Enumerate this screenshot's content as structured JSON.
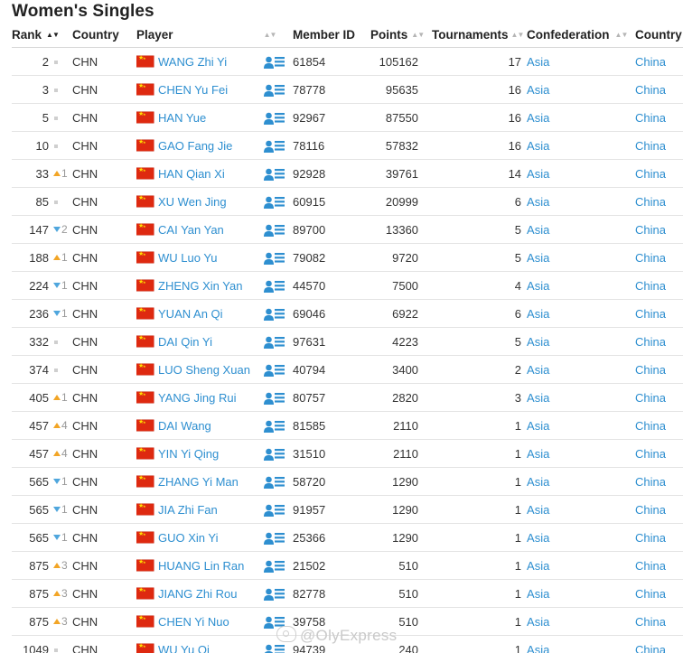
{
  "page": {
    "title": "Women's Singles"
  },
  "table": {
    "columns": {
      "rank": "Rank",
      "country": "Country",
      "player": "Player",
      "member_id": "Member ID",
      "points": "Points",
      "tournaments": "Tournaments",
      "confederation": "Confederation",
      "country2": "Country"
    },
    "rows": [
      {
        "rank": "2",
        "move_dir": "same",
        "move": "",
        "country": "CHN",
        "player": "WANG Zhi Yi",
        "member_id": "61854",
        "points": "105162",
        "tournaments": "17",
        "confederation": "Asia",
        "country_name": "China"
      },
      {
        "rank": "3",
        "move_dir": "same",
        "move": "",
        "country": "CHN",
        "player": "CHEN Yu Fei",
        "member_id": "78778",
        "points": "95635",
        "tournaments": "16",
        "confederation": "Asia",
        "country_name": "China"
      },
      {
        "rank": "5",
        "move_dir": "same",
        "move": "",
        "country": "CHN",
        "player": "HAN Yue",
        "member_id": "92967",
        "points": "87550",
        "tournaments": "16",
        "confederation": "Asia",
        "country_name": "China"
      },
      {
        "rank": "10",
        "move_dir": "same",
        "move": "",
        "country": "CHN",
        "player": "GAO Fang Jie",
        "member_id": "78116",
        "points": "57832",
        "tournaments": "16",
        "confederation": "Asia",
        "country_name": "China"
      },
      {
        "rank": "33",
        "move_dir": "up",
        "move": "1",
        "country": "CHN",
        "player": "HAN Qian Xi",
        "member_id": "92928",
        "points": "39761",
        "tournaments": "14",
        "confederation": "Asia",
        "country_name": "China"
      },
      {
        "rank": "85",
        "move_dir": "same",
        "move": "",
        "country": "CHN",
        "player": "XU Wen Jing",
        "member_id": "60915",
        "points": "20999",
        "tournaments": "6",
        "confederation": "Asia",
        "country_name": "China"
      },
      {
        "rank": "147",
        "move_dir": "down",
        "move": "2",
        "country": "CHN",
        "player": "CAI Yan Yan",
        "member_id": "89700",
        "points": "13360",
        "tournaments": "5",
        "confederation": "Asia",
        "country_name": "China"
      },
      {
        "rank": "188",
        "move_dir": "up",
        "move": "1",
        "country": "CHN",
        "player": "WU Luo Yu",
        "member_id": "79082",
        "points": "9720",
        "tournaments": "5",
        "confederation": "Asia",
        "country_name": "China"
      },
      {
        "rank": "224",
        "move_dir": "down",
        "move": "1",
        "country": "CHN",
        "player": "ZHENG Xin Yan",
        "member_id": "44570",
        "points": "7500",
        "tournaments": "4",
        "confederation": "Asia",
        "country_name": "China"
      },
      {
        "rank": "236",
        "move_dir": "down",
        "move": "1",
        "country": "CHN",
        "player": "YUAN An Qi",
        "member_id": "69046",
        "points": "6922",
        "tournaments": "6",
        "confederation": "Asia",
        "country_name": "China"
      },
      {
        "rank": "332",
        "move_dir": "same",
        "move": "",
        "country": "CHN",
        "player": "DAI Qin Yi",
        "member_id": "97631",
        "points": "4223",
        "tournaments": "5",
        "confederation": "Asia",
        "country_name": "China"
      },
      {
        "rank": "374",
        "move_dir": "same",
        "move": "",
        "country": "CHN",
        "player": "LUO Sheng Xuan",
        "member_id": "40794",
        "points": "3400",
        "tournaments": "2",
        "confederation": "Asia",
        "country_name": "China"
      },
      {
        "rank": "405",
        "move_dir": "up",
        "move": "1",
        "country": "CHN",
        "player": "YANG Jing Rui",
        "member_id": "80757",
        "points": "2820",
        "tournaments": "3",
        "confederation": "Asia",
        "country_name": "China"
      },
      {
        "rank": "457",
        "move_dir": "up",
        "move": "4",
        "country": "CHN",
        "player": "DAI Wang",
        "member_id": "81585",
        "points": "2110",
        "tournaments": "1",
        "confederation": "Asia",
        "country_name": "China"
      },
      {
        "rank": "457",
        "move_dir": "up",
        "move": "4",
        "country": "CHN",
        "player": "YIN Yi Qing",
        "member_id": "31510",
        "points": "2110",
        "tournaments": "1",
        "confederation": "Asia",
        "country_name": "China"
      },
      {
        "rank": "565",
        "move_dir": "down",
        "move": "1",
        "country": "CHN",
        "player": "ZHANG Yi Man",
        "member_id": "58720",
        "points": "1290",
        "tournaments": "1",
        "confederation": "Asia",
        "country_name": "China"
      },
      {
        "rank": "565",
        "move_dir": "down",
        "move": "1",
        "country": "CHN",
        "player": "JIA Zhi Fan",
        "member_id": "91957",
        "points": "1290",
        "tournaments": "1",
        "confederation": "Asia",
        "country_name": "China"
      },
      {
        "rank": "565",
        "move_dir": "down",
        "move": "1",
        "country": "CHN",
        "player": "GUO Xin Yi",
        "member_id": "25366",
        "points": "1290",
        "tournaments": "1",
        "confederation": "Asia",
        "country_name": "China"
      },
      {
        "rank": "875",
        "move_dir": "up",
        "move": "3",
        "country": "CHN",
        "player": "HUANG Lin Ran",
        "member_id": "21502",
        "points": "510",
        "tournaments": "1",
        "confederation": "Asia",
        "country_name": "China"
      },
      {
        "rank": "875",
        "move_dir": "up",
        "move": "3",
        "country": "CHN",
        "player": "JIANG Zhi Rou",
        "member_id": "82778",
        "points": "510",
        "tournaments": "1",
        "confederation": "Asia",
        "country_name": "China"
      },
      {
        "rank": "875",
        "move_dir": "up",
        "move": "3",
        "country": "CHN",
        "player": "CHEN Yi Nuo",
        "member_id": "39758",
        "points": "510",
        "tournaments": "1",
        "confederation": "Asia",
        "country_name": "China"
      },
      {
        "rank": "1049",
        "move_dir": "same",
        "move": "",
        "country": "CHN",
        "player": "WU Yu Qi",
        "member_id": "94739",
        "points": "240",
        "tournaments": "1",
        "confederation": "Asia",
        "country_name": "China"
      }
    ]
  },
  "watermark": {
    "text": "@OlyExpress"
  },
  "icons": {
    "flag": "china-flag-icon",
    "profile": "player-profile-icon",
    "sort": "sort-arrows-icon",
    "movement_up": "rank-up-arrow-icon",
    "movement_down": "rank-down-arrow-icon",
    "movement_same": "rank-unchanged-icon"
  },
  "colors": {
    "link": "#2e8fd0",
    "up": "#f2a526",
    "down": "#4fa6dd",
    "flag_red": "#de2910",
    "flag_star": "#ffde00"
  }
}
